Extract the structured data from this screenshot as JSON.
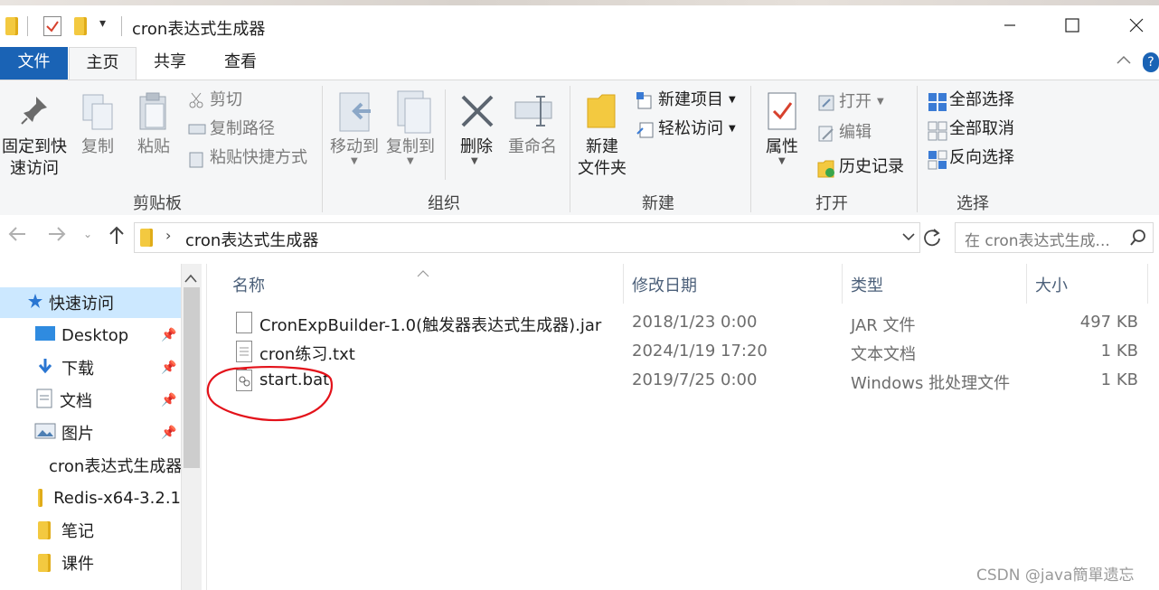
{
  "window": {
    "title": "cron表达式生成器",
    "controls": [
      "—",
      "☐",
      "✕"
    ]
  },
  "ribbon_tabs": [
    "文件",
    "主页",
    "共享",
    "查看"
  ],
  "ribbon": {
    "clipboard": {
      "pin_label_1": "固定到快",
      "pin_label_2": "速访问",
      "copy": "复制",
      "paste": "粘贴",
      "cut": "剪切",
      "copy_path": "复制路径",
      "paste_shortcut": "粘贴快捷方式",
      "group": "剪贴板"
    },
    "organize": {
      "move_to": "移动到",
      "copy_to": "复制到",
      "delete": "删除",
      "rename": "重命名",
      "group": "组织"
    },
    "new": {
      "new_folder_1": "新建",
      "new_folder_2": "文件夹",
      "new_item": "新建项目",
      "easy_access": "轻松访问",
      "group": "新建"
    },
    "open": {
      "properties": "属性",
      "open": "打开",
      "edit": "编辑",
      "history": "历史记录",
      "group": "打开"
    },
    "select": {
      "select_all": "全部选择",
      "select_none": "全部取消",
      "invert": "反向选择",
      "group": "选择"
    }
  },
  "address": {
    "path": "cron表达式生成器",
    "search_placeholder": "在 cron表达式生成..."
  },
  "navpane": {
    "quick_access": "快速访问",
    "items": [
      {
        "label": "Desktop",
        "pinned": true
      },
      {
        "label": "下载",
        "pinned": true
      },
      {
        "label": "文档",
        "pinned": true
      },
      {
        "label": "图片",
        "pinned": true
      },
      {
        "label": "cron表达式生成器",
        "pinned": false
      },
      {
        "label": "Redis-x64-3.2.1",
        "pinned": false
      },
      {
        "label": "笔记",
        "pinned": false
      },
      {
        "label": "课件",
        "pinned": false
      }
    ]
  },
  "columns": {
    "name": "名称",
    "date": "修改日期",
    "type": "类型",
    "size": "大小"
  },
  "files": [
    {
      "name": "CronExpBuilder-1.0(触发器表达式生成器).jar",
      "date": "2018/1/23 0:00",
      "type": "JAR 文件",
      "size": "497 KB"
    },
    {
      "name": "cron练习.txt",
      "date": "2024/1/19 17:20",
      "type": "文本文档",
      "size": "1 KB"
    },
    {
      "name": "start.bat",
      "date": "2019/7/25 0:00",
      "type": "Windows 批处理文件",
      "size": "1 KB"
    }
  ],
  "watermark": "CSDN @java簡單遗忘",
  "colors": {
    "file_tab": "#1a63b5",
    "folder": "#f3c940",
    "annotation": "#e3121a"
  }
}
